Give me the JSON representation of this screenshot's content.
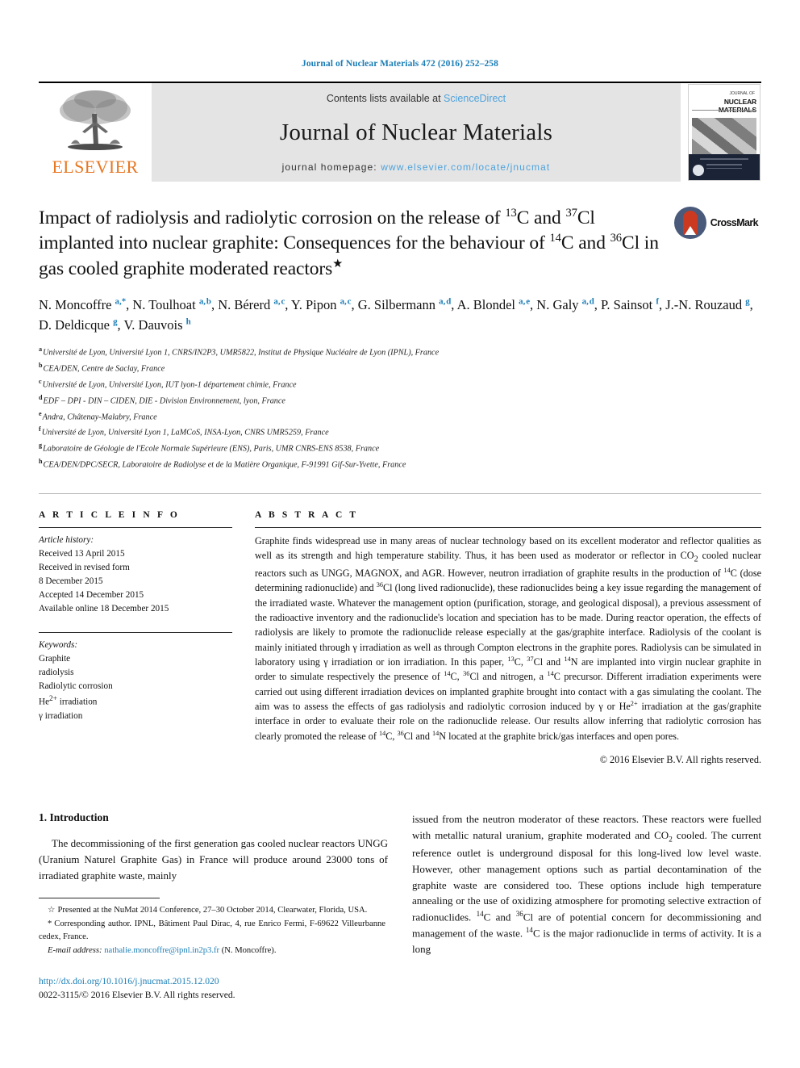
{
  "running_head": "Journal of Nuclear Materials 472 (2016) 252–258",
  "masthead": {
    "publisher_name": "ELSEVIER",
    "contents_prefix": "Contents lists available at ",
    "contents_link": "ScienceDirect",
    "journal_name": "Journal of Nuclear Materials",
    "homepage_prefix": "journal homepage: ",
    "homepage_url": "www.elsevier.com/locate/jnucmat",
    "cover": {
      "title_line1": "JOURNAL OF",
      "title_line2": "NUCLEAR MATERIALS",
      "sidenote": "www.elsevier.com/locate/jnucmat"
    },
    "colors": {
      "link_blue": "#4ea3dd",
      "elsevier_orange": "#e87722",
      "band_gray": "#e4e4e4"
    }
  },
  "article": {
    "title_html": "Impact of radiolysis and radiolytic corrosion on the release of <sup>13</sup>C and <sup>37</sup>Cl implanted into nuclear graphite: Consequences for the behaviour of <sup>14</sup>C and <sup>36</sup>Cl in gas cooled graphite moderated reactors<sup class=\"star\">&#9733;</sup>",
    "crossmark_label": "CrossMark",
    "authors_html": "N. Moncoffre <sup>a,&#42;</sup>, N. Toulhoat <sup>a,&#8202;b</sup>, N. B&eacute;rerd <sup>a,&#8202;c</sup>, Y. Pipon <sup>a,&#8202;c</sup>, G. Silbermann <sup>a,&#8202;d</sup>, A. Blondel <sup>a,&#8202;e</sup>, N. Galy <sup>a,&#8202;d</sup>, P. Sainsot <sup>f</sup>, J.-N. Rouzaud <sup>g</sup>, D. Deldicque <sup>g</sup>, V. Dauvois <sup>h</sup>",
    "affiliations": [
      {
        "mark": "a",
        "text": "Université de Lyon, Université Lyon 1, CNRS/IN2P3, UMR5822, Institut de Physique Nucléaire de Lyon (IPNL), France"
      },
      {
        "mark": "b",
        "text": "CEA/DEN, Centre de Saclay, France"
      },
      {
        "mark": "c",
        "text": "Université de Lyon, Université Lyon, IUT lyon-1 département chimie, France"
      },
      {
        "mark": "d",
        "text": "EDF – DPI - DIN – CIDEN, DIE - Division Environnement, lyon, France"
      },
      {
        "mark": "e",
        "text": "Andra, Châtenay-Malabry, France"
      },
      {
        "mark": "f",
        "text": "Université de Lyon, Université Lyon 1, LaMCoS, INSA-Lyon, CNRS UMR5259, France"
      },
      {
        "mark": "g",
        "text": "Laboratoire de Géologie de l'Ecole Normale Supérieure (ENS), Paris, UMR CNRS-ENS 8538, France"
      },
      {
        "mark": "h",
        "text": "CEA/DEN/DPC/SECR, Laboratoire de Radiolyse et de la Matière Organique, F-91991 Gif-Sur-Yvette, France"
      }
    ]
  },
  "article_info": {
    "heading": "A R T I C L E   I N F O",
    "history_label": "Article history:",
    "history": [
      "Received 13 April 2015",
      "Received in revised form",
      "8 December 2015",
      "Accepted 14 December 2015",
      "Available online 18 December 2015"
    ],
    "keywords_label": "Keywords:",
    "keywords_html": [
      "Graphite",
      "radiolysis",
      "Radiolytic corrosion",
      "He<sup>2+</sup> irradiation",
      "&gamma; irradiation"
    ]
  },
  "abstract": {
    "heading": "A B S T R A C T",
    "body_html": "Graphite finds widespread use in many areas of nuclear technology based on its excellent moderator and reflector qualities as well as its strength and high temperature stability. Thus, it has been used as moderator or reflector in CO<sub>2</sub> cooled nuclear reactors such as UNGG, MAGNOX, and AGR. However, neutron irradiation of graphite results in the production of <sup>14</sup>C (dose determining radionuclide) and <sup>36</sup>Cl (long lived radionuclide), these radionuclides being a key issue regarding the management of the irradiated waste. Whatever the management option (purification, storage, and geological disposal), a previous assessment of the radioactive inventory and the radionuclide's location and speciation has to be made. During reactor operation, the effects of radiolysis are likely to promote the radionuclide release especially at the gas/graphite interface. Radiolysis of the coolant is mainly initiated through &gamma; irradiation as well as through Compton electrons in the graphite pores. Radiolysis can be simulated in laboratory using &gamma; irradiation or ion irradiation. In this paper, <sup>13</sup>C, <sup>37</sup>Cl and <sup>14</sup>N are implanted into virgin nuclear graphite in order to simulate respectively the presence of <sup>14</sup>C, <sup>36</sup>Cl and nitrogen, a <sup>14</sup>C precursor. Different irradiation experiments were carried out using different irradiation devices on implanted graphite brought into contact with a gas simulating the coolant. The aim was to assess the effects of gas radiolysis and radiolytic corrosion induced by &gamma; or He<sup>2+</sup> irradiation at the gas/graphite interface in order to evaluate their role on the radionuclide release. Our results allow inferring that radiolytic corrosion has clearly promoted the release of <sup>14</sup>C, <sup>36</sup>Cl and <sup>14</sup>N located at the graphite brick/gas interfaces and open pores.",
    "copyright": "© 2016 Elsevier B.V. All rights reserved."
  },
  "introduction": {
    "section_number_title": "1. Introduction",
    "left_paragraph_html": "The decommissioning of the first generation gas cooled nuclear reactors UNGG (Uranium Naturel Graphite Gas) in France will produce around 23000 tons of irradiated graphite waste, mainly",
    "right_paragraph_html": "issued from the neutron moderator of these reactors. These reactors were fuelled with metallic natural uranium, graphite moderated and CO<sub>2</sub> cooled. The current reference outlet is underground disposal for this long-lived low level waste. However, other management options such as partial decontamination of the graphite waste are considered too. These options include high temperature annealing or the use of oxidizing atmosphere for promoting selective extraction of radionuclides. <sup>14</sup>C and <sup>36</sup>Cl are of potential concern for decommissioning and management of the waste. <sup>14</sup>C is the major radionuclide in terms of activity. It is a long"
  },
  "footnotes": {
    "conference_mark": "☆",
    "conference_text": "Presented at the NuMat 2014 Conference, 27–30 October 2014, Clearwater, Florida, USA.",
    "corresponding_mark": "*",
    "corresponding_text": "Corresponding author. IPNL, Bâtiment Paul Dirac, 4, rue Enrico Fermi, F-69622 Villeurbanne cedex, France.",
    "email_label": "E-mail address:",
    "email_link": "nathalie.moncoffre@ipnl.in2p3.fr",
    "email_suffix": "(N. Moncoffre)."
  },
  "doi_block": {
    "doi_url": "http://dx.doi.org/10.1016/j.jnucmat.2015.12.020",
    "issn_line": "0022-3115/© 2016 Elsevier B.V. All rights reserved."
  }
}
